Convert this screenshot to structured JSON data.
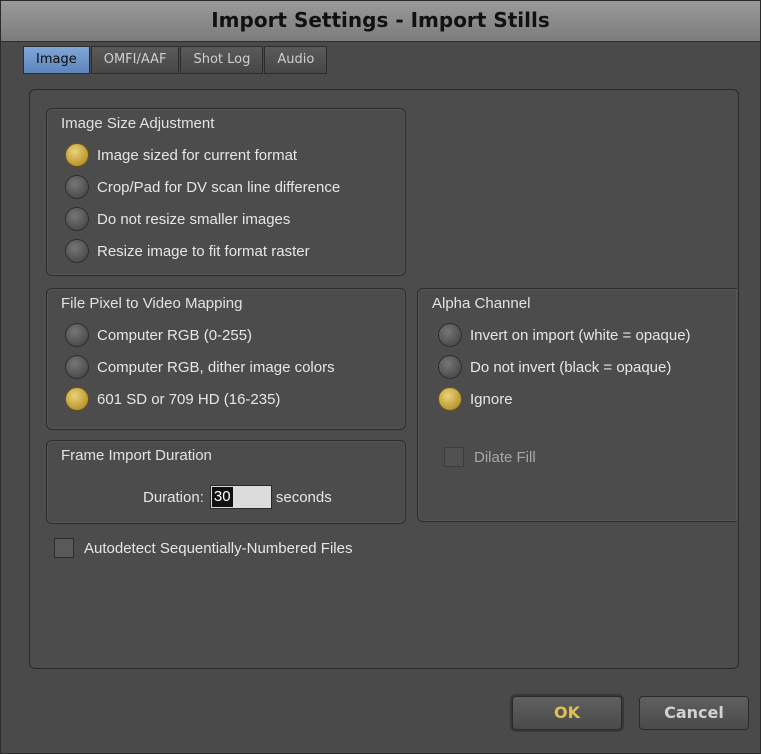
{
  "window": {
    "title": "Import Settings - Import Stills"
  },
  "tabs": [
    {
      "label": "Image",
      "active": true
    },
    {
      "label": "OMFI/AAF",
      "active": false
    },
    {
      "label": "Shot Log",
      "active": false
    },
    {
      "label": "Audio",
      "active": false
    }
  ],
  "image_size": {
    "title": "Image Size Adjustment",
    "options": [
      {
        "label": "Image sized for current format",
        "selected": true
      },
      {
        "label": "Crop/Pad for DV scan line difference",
        "selected": false
      },
      {
        "label": "Do not resize smaller images",
        "selected": false
      },
      {
        "label": "Resize image to fit format raster",
        "selected": false
      }
    ]
  },
  "pixel_mapping": {
    "title": "File Pixel to Video Mapping",
    "options": [
      {
        "label": "Computer RGB (0-255)",
        "selected": false
      },
      {
        "label": "Computer RGB, dither image colors",
        "selected": false
      },
      {
        "label": "601 SD or 709 HD (16-235)",
        "selected": true
      }
    ]
  },
  "frame_import": {
    "title": "Frame Import Duration",
    "duration_label": "Duration:",
    "duration_value": "30",
    "unit": "seconds"
  },
  "alpha_channel": {
    "title": "Alpha Channel",
    "options": [
      {
        "label": "Invert on import (white = opaque)",
        "selected": false
      },
      {
        "label": "Do not invert (black = opaque)",
        "selected": false
      },
      {
        "label": "Ignore",
        "selected": true
      }
    ],
    "dilate_fill": {
      "label": "Dilate Fill",
      "checked": false,
      "enabled": false
    }
  },
  "autodetect": {
    "label": "Autodetect Sequentially-Numbered Files",
    "checked": false
  },
  "buttons": {
    "ok": "OK",
    "cancel": "Cancel"
  },
  "colors": {
    "accent_gold": "#e1c04f",
    "tab_active": "#6f98cc",
    "background": "#4a4a4a"
  }
}
